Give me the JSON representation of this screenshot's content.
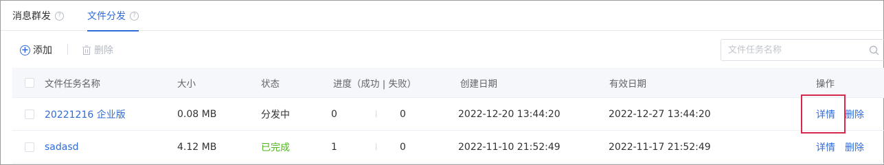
{
  "tabs": [
    {
      "label": "消息群发",
      "active": false
    },
    {
      "label": "文件分发",
      "active": true
    }
  ],
  "help_glyph": "?",
  "toolbar": {
    "add_label": "添加",
    "delete_label": "删除"
  },
  "search": {
    "placeholder": "文件任务名称",
    "value": ""
  },
  "table": {
    "headers": {
      "name": "文件任务名称",
      "size": "大小",
      "status": "状态",
      "progress": "进度（成功 | 失败）",
      "created": "创建日期",
      "expires": "有效日期",
      "actions": "操作"
    },
    "progress_separator": "|",
    "rows": [
      {
        "name": "20221216 企业版",
        "size": "0.08 MB",
        "status": "分发中",
        "success": "0",
        "fail": "0",
        "created": "2022-12-20 13:44:20",
        "expires": "2022-12-27 13:44:20",
        "detail": "详情",
        "delete": "删除"
      },
      {
        "name": "sadasd",
        "size": "4.12 MB",
        "status": "已完成",
        "success": "1",
        "fail": "0",
        "created": "2022-11-10 21:52:49",
        "expires": "2022-11-17 21:52:49",
        "detail": "详情",
        "delete": "删除"
      }
    ]
  },
  "colors": {
    "accent": "#2f6bd8",
    "status_done": "#52b324",
    "highlight": "#d9264d"
  },
  "icons": {
    "help": "help-icon",
    "add": "plus-circle-icon",
    "delete": "trash-icon",
    "search": "search-icon"
  }
}
